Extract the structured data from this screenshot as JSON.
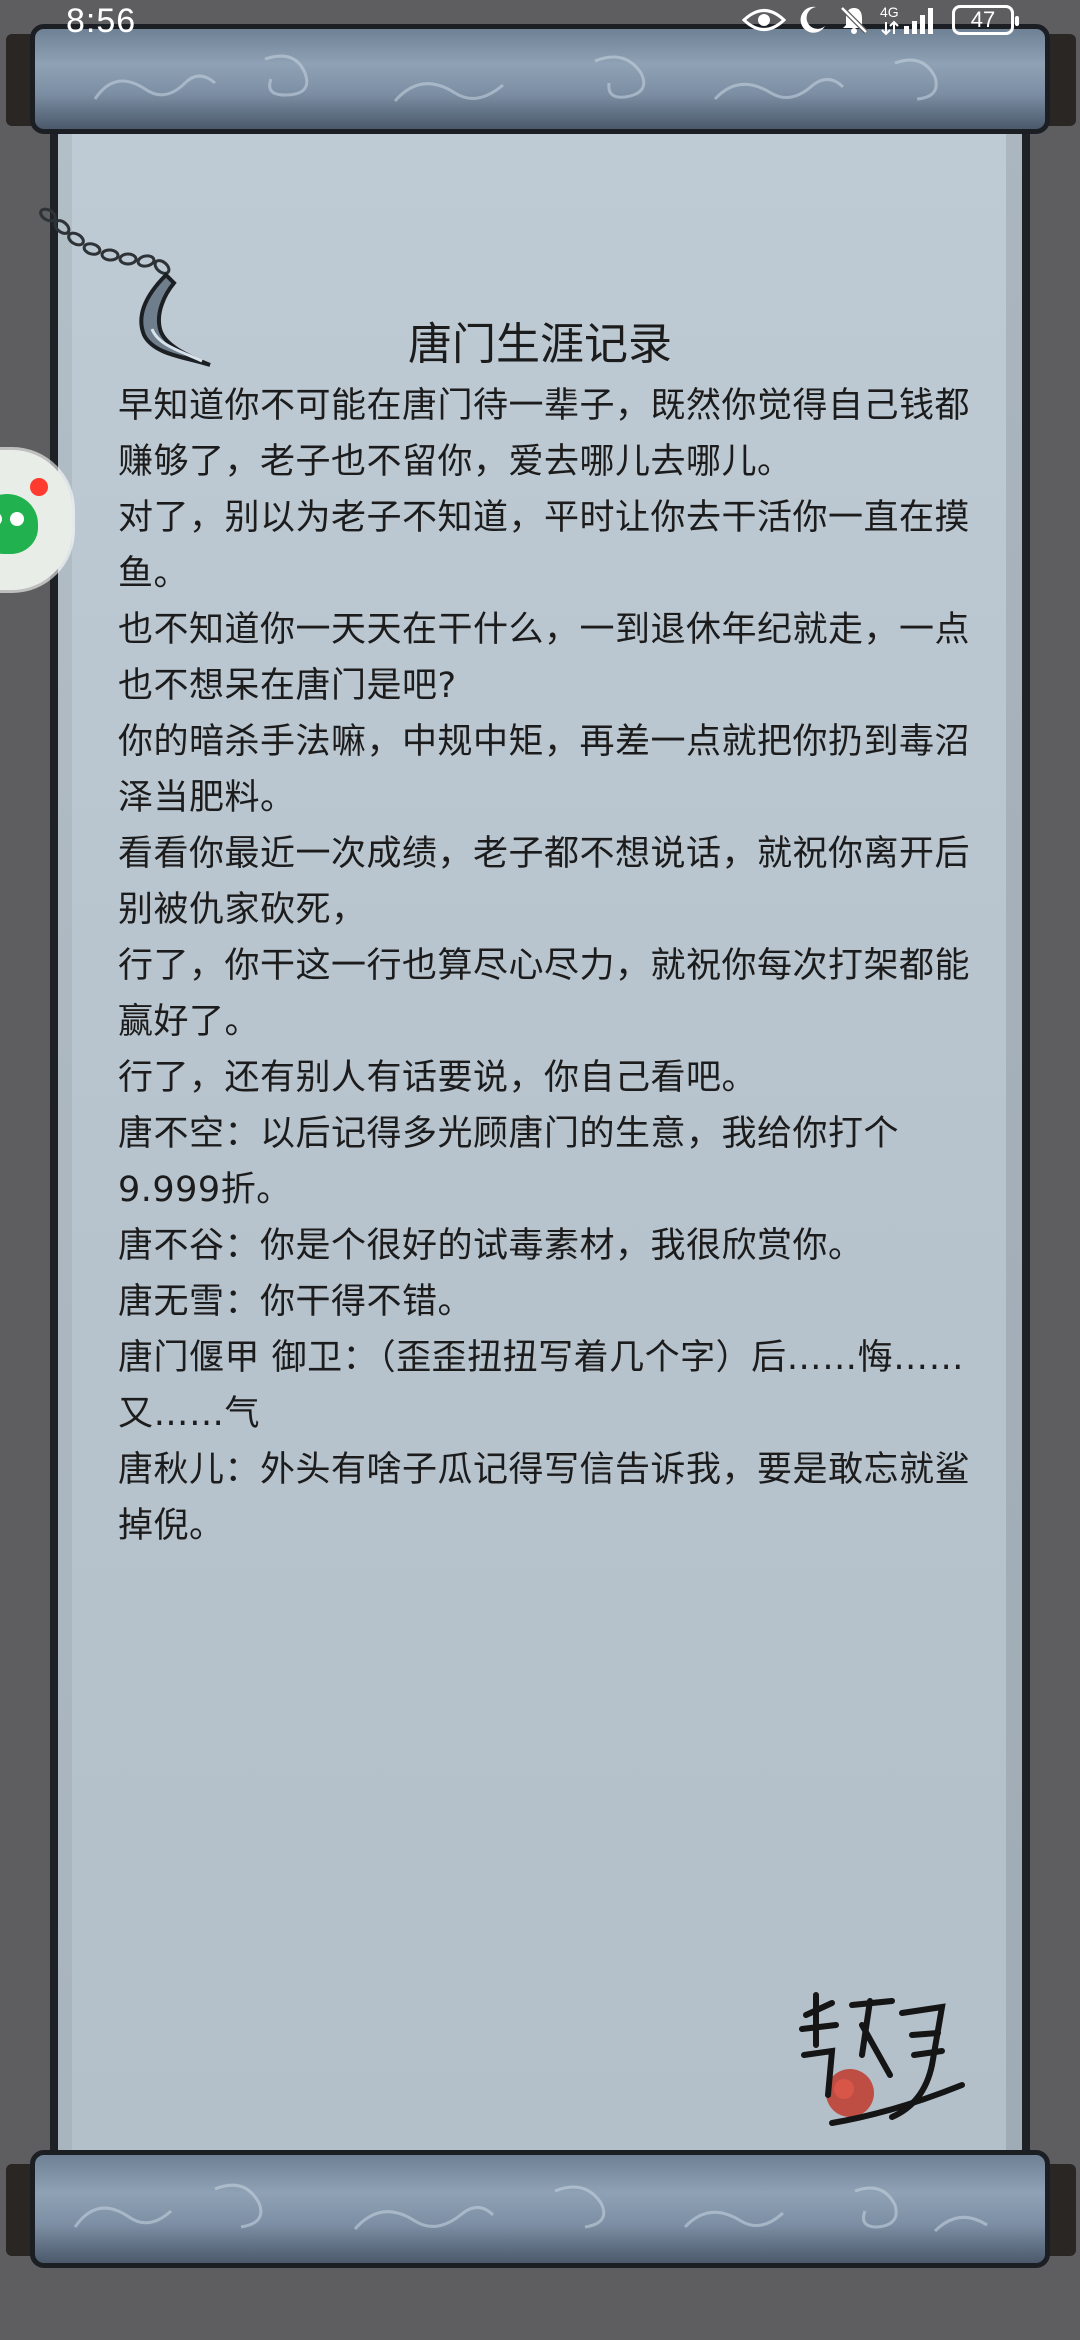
{
  "status_bar": {
    "time": "8:56",
    "network": "4G",
    "battery": "47"
  },
  "scroll": {
    "title": "唐门生涯记录",
    "lines": [
      "早知道你不可能在唐门待一辈子，既然你觉得自己钱都赚够了，老子也不留你，爱去哪儿去哪儿。",
      "对了，别以为老子不知道，平时让你去干活你一直在摸鱼。",
      "也不知道你一天天在干什么，一到退休年纪就走，一点也不想呆在唐门是吧?",
      "你的暗杀手法嘛，中规中矩，再差一点就把你扔到毒沼泽当肥料。",
      "看看你最近一次成绩，老子都不想说话，就祝你离开后别被仇家砍死，",
      "行了，你干这一行也算尽心尽力，就祝你每次打架都能赢好了。",
      "行了，还有别人有话要说，你自己看吧。",
      "唐不空：以后记得多光顾唐门的生意，我给你打个9.999折。",
      "唐不谷：你是个很好的试毒素材，我很欣赏你。",
      "唐无雪：你干得不错。",
      "唐门偃甲 御卫：（歪歪扭扭写着几个字）后……悔……又……气",
      "唐秋儿：外头有啥子瓜记得写信告诉我，要是敢忘就鲨掉倪。"
    ]
  },
  "signature": "唐不騎",
  "icons": {
    "eye": "eye-icon",
    "moon": "moon-icon",
    "mute": "bell-off-icon",
    "signal": "signal-icon",
    "battery": "battery-icon",
    "assistant": "floating-assistant-icon",
    "ornament": "chain-ornament-icon"
  },
  "colors": {
    "paper": "#bfcbd4",
    "roller": "#7c8ea3",
    "background": "#5e5e60",
    "seal": "#c0392b"
  }
}
